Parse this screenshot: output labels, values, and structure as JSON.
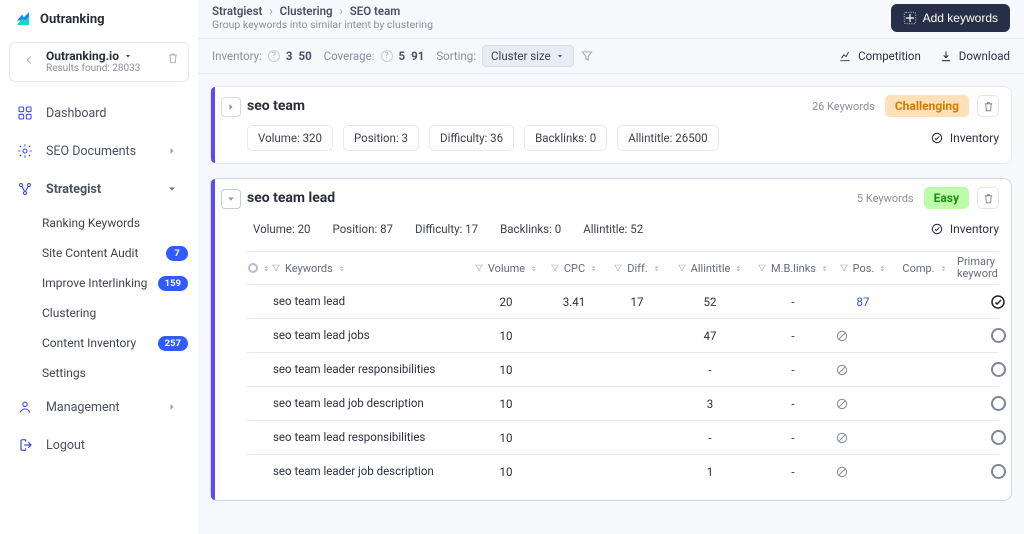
{
  "brand": "Outranking",
  "workspace": {
    "name": "Outranking.io",
    "results_text": "Results found: 28033"
  },
  "nav": {
    "dashboard": "Dashboard",
    "seo_documents": "SEO Documents",
    "strategist": "Strategist",
    "management": "Management",
    "logout": "Logout",
    "children": {
      "ranking": "Ranking Keywords",
      "audit": "Site Content Audit",
      "audit_badge": "7",
      "inter": "Improve Interlinking",
      "inter_badge": "159",
      "clustering": "Clustering",
      "inventory": "Content Inventory",
      "inventory_badge": "257",
      "settings": "Settings"
    }
  },
  "breadcrumbs": {
    "a": "Stratgiest",
    "b": "Clustering",
    "c": "SEO team",
    "desc": "Group keywords into similar intent by clustering"
  },
  "actions": {
    "add_keywords": "Add keywords",
    "competition": "Competition",
    "download": "Download",
    "inventory": "Inventory"
  },
  "filters": {
    "inventory_label": "Inventory:",
    "inventory_v1": "3",
    "inventory_v2": "50",
    "coverage_label": "Coverage:",
    "coverage_v1": "5",
    "coverage_v2": "91",
    "sorting_label": "Sorting:",
    "cluster_size": "Cluster size"
  },
  "clusters": [
    {
      "name": "seo team",
      "keyword_count_text": "26 Keywords",
      "difficulty_tag": "Challenging",
      "metrics": {
        "volume": "Volume: 320",
        "position": "Position: 3",
        "difficulty": "Difficulty: 36",
        "backlinks": "Backlinks: 0",
        "allintitle": "Allintitle: 26500"
      }
    },
    {
      "name": "seo team lead",
      "keyword_count_text": "5 Keywords",
      "difficulty_tag": "Easy",
      "metrics": {
        "volume": "Volume: 20",
        "position": "Position: 87",
        "difficulty": "Difficulty: 17",
        "backlinks": "Backlinks: 0",
        "allintitle": "Allintitle: 52"
      }
    }
  ],
  "table": {
    "headers": {
      "keywords": "Keywords",
      "volume": "Volume",
      "cpc": "CPC",
      "diff": "Diff.",
      "allintitle": "Allintitle",
      "mblinks": "M.B.links",
      "pos": "Pos.",
      "comp": "Comp.",
      "primary": "Primary keyword"
    },
    "rows": [
      {
        "kw": "seo team lead",
        "vol": "20",
        "cpc": "3.41",
        "diff": "17",
        "ait": "52",
        "mbl": "-",
        "pos": "87",
        "pos_link": true,
        "comp": "",
        "primary": true
      },
      {
        "kw": "seo team lead jobs",
        "vol": "10",
        "cpc": "",
        "diff": "",
        "ait": "47",
        "mbl": "-",
        "pos": "",
        "pos_link": false,
        "comp": "",
        "primary": false
      },
      {
        "kw": "seo team leader responsibilities",
        "vol": "10",
        "cpc": "",
        "diff": "",
        "ait": "-",
        "mbl": "-",
        "pos": "",
        "pos_link": false,
        "comp": "",
        "primary": false
      },
      {
        "kw": "seo team lead job description",
        "vol": "10",
        "cpc": "",
        "diff": "",
        "ait": "3",
        "mbl": "-",
        "pos": "",
        "pos_link": false,
        "comp": "",
        "primary": false
      },
      {
        "kw": "seo team lead responsibilities",
        "vol": "10",
        "cpc": "",
        "diff": "",
        "ait": "-",
        "mbl": "-",
        "pos": "",
        "pos_link": false,
        "comp": "",
        "primary": false
      },
      {
        "kw": "seo team leader job description",
        "vol": "10",
        "cpc": "",
        "diff": "",
        "ait": "1",
        "mbl": "-",
        "pos": "",
        "pos_link": false,
        "comp": "",
        "primary": false
      }
    ]
  }
}
